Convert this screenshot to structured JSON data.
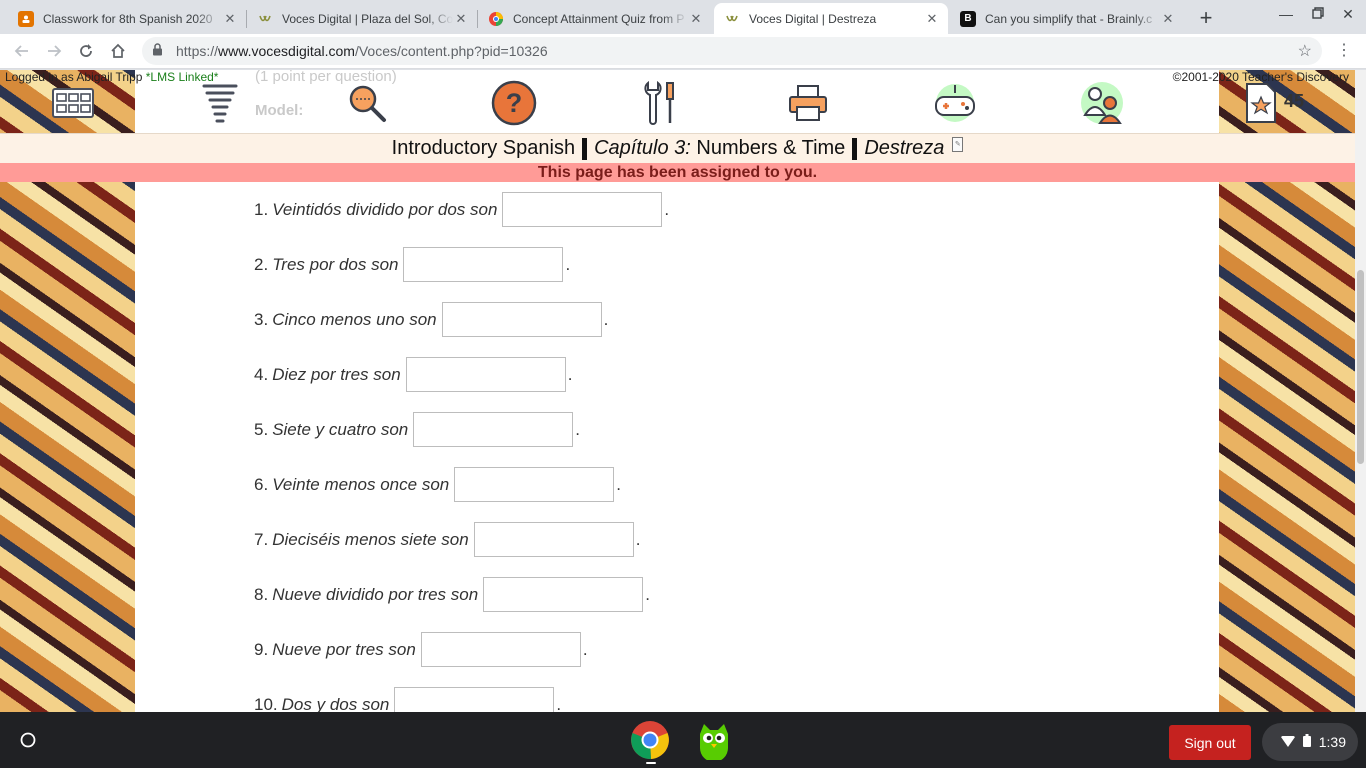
{
  "browser": {
    "tabs": [
      {
        "title": "Classwork for 8th Spanish 2020",
        "favicon": "google-classroom-icon",
        "active": false
      },
      {
        "title": "Voces Digital | Plaza del Sol, Co",
        "favicon": "voces-icon",
        "active": false
      },
      {
        "title": "Concept Attainment Quiz from P",
        "favicon": "google-docs-icon",
        "active": false
      },
      {
        "title": "Voces Digital | Destreza",
        "favicon": "voces-icon",
        "active": true
      },
      {
        "title": "Can you simplify that - Brainly.c",
        "favicon": "brainly-icon",
        "active": false
      }
    ],
    "new_tab_label": "+",
    "url": {
      "scheme": "https://",
      "host": "www.vocesdigital.com",
      "path": "/Voces/content.php?pid=10326"
    }
  },
  "header": {
    "logged_in_prefix": "Logged in as Abigail Tripp ",
    "lms_label": "*LMS Linked*",
    "copyright": "©2001-2020 Teacher's Discovery",
    "points": "45",
    "ghost_line1": "(1 point per question)",
    "ghost_line2": "Model:",
    "icons": [
      "grid-menu-icon",
      "tornado-icon",
      "search-magnifier-icon",
      "help-question-icon",
      "tools-icon",
      "printer-icon",
      "game-controller-icon",
      "people-icon",
      "star-document-icon"
    ]
  },
  "title_bar": {
    "course": "Introductory Spanish",
    "chapter_label": "Capítulo 3:",
    "chapter_name": "Numbers & Time",
    "section": "Destreza"
  },
  "banner": {
    "text": "This page has been assigned to you."
  },
  "questions": [
    {
      "number": "1.",
      "prompt": "Veintidós dividido por dos son",
      "answer": ""
    },
    {
      "number": "2.",
      "prompt": "Tres por dos son",
      "answer": ""
    },
    {
      "number": "3.",
      "prompt": "Cinco menos uno son",
      "answer": ""
    },
    {
      "number": "4.",
      "prompt": "Diez por tres son",
      "answer": ""
    },
    {
      "number": "5.",
      "prompt": "Siete y cuatro son",
      "answer": ""
    },
    {
      "number": "6.",
      "prompt": "Veinte menos once son",
      "answer": ""
    },
    {
      "number": "7.",
      "prompt": "Dieciséis menos siete son",
      "answer": ""
    },
    {
      "number": "8.",
      "prompt": "Nueve dividido por tres son",
      "answer": ""
    },
    {
      "number": "9.",
      "prompt": "Nueve por tres son",
      "answer": ""
    },
    {
      "number": "10.",
      "prompt": "Dos y dos son",
      "answer": ""
    }
  ],
  "shelf": {
    "sign_out": "Sign out",
    "time": "1:39",
    "apps": [
      "chrome-icon",
      "duolingo-icon"
    ]
  },
  "colors": {
    "assigned_banner": "#ff9b97",
    "title_bar": "#fdf2e6",
    "sign_out": "#c5221f",
    "help_orange": "#e8753a",
    "lms_green": "#1a7f1a"
  }
}
